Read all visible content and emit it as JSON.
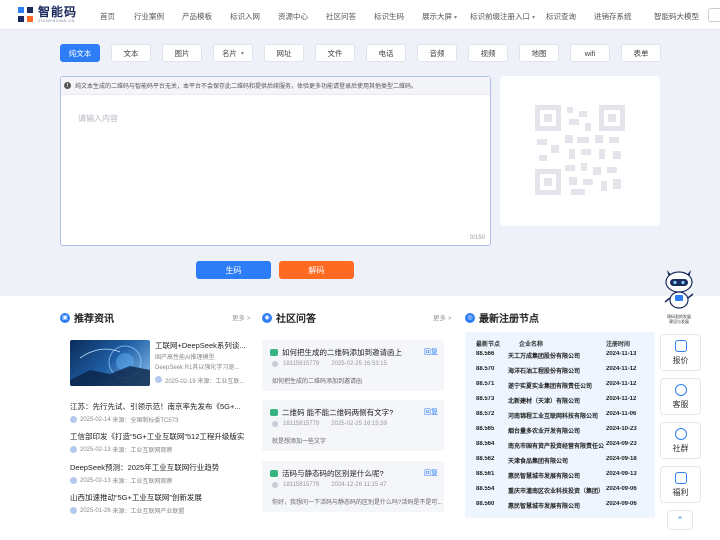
{
  "logo": {
    "name": "智能码",
    "domain": "ZHINENGMA.CN"
  },
  "nav": [
    {
      "label": "首页"
    },
    {
      "label": "行业案例"
    },
    {
      "label": "产品模板"
    },
    {
      "label": "标识入网"
    },
    {
      "label": "资源中心"
    },
    {
      "label": "社区问答"
    },
    {
      "label": "标识生码"
    },
    {
      "label": "展示大屏"
    },
    {
      "label": "标识前缀注册入口"
    },
    {
      "label": "标识查询"
    },
    {
      "label": "进销存系统"
    },
    {
      "label": "智能码大模型"
    }
  ],
  "tabs": [
    "纯文本",
    "文本",
    "图片",
    "名片",
    "网址",
    "文件",
    "电话",
    "音频",
    "视频",
    "地图",
    "wifi",
    "表单"
  ],
  "editor": {
    "notice": "纯文本生成的二维码与智能码平台无关，本平台不会保存此二维码和提供后续服务，体验更多功能请登录后使用其他类型二维码。",
    "placeholder": "请输入内容",
    "counter": "0/150"
  },
  "buttons": {
    "generate": "生码",
    "decode": "解码"
  },
  "news": {
    "title": "推荐资讯",
    "more": "更多 >",
    "feature": {
      "title": "工联网+DeepSeek系列谈...",
      "desc1": "国产高性能AI推理模型",
      "desc2": "DeepSeek R1其以强化学习驱...",
      "date": "2025-02-19",
      "source": "来源：工业互联..."
    },
    "items": [
      {
        "title": "江苏：先行先试、引领示范！南京率先发布《5G+...",
        "date": "2025-02-14",
        "source": "来源：全国制标委TC573"
      },
      {
        "title": "工信部印发《打造“5G+工业互联网”512工程升级版实...",
        "date": "2025-02-13",
        "source": "来源：工业互联网观察"
      },
      {
        "title": "DeepSeek预测：2025年工业互联网行业趋势",
        "date": "2025-02-13",
        "source": "来源：工业互联网观察"
      },
      {
        "title": "山西加速推动“5G+工业互联网”创新发展",
        "date": "2025-01-26",
        "source": "来源：工业互联网产业联盟"
      }
    ]
  },
  "qa": {
    "title": "社区问答",
    "more": "更多 >",
    "reply_label": "回复",
    "items": [
      {
        "q": "如何把生成的二维码添加到邀请函上",
        "user": "18115815779",
        "date": "2025-02-25 16:53:15",
        "a": "如何把生成的二维码添加到邀请函"
      },
      {
        "q": "二维码 能不能二维码两侧有文字?",
        "user": "18115815779",
        "date": "2025-02-25 16:15:39",
        "a": "就是想添加一些文字"
      },
      {
        "q": "活码与静态码的区别是什么呢?",
        "user": "18115815779",
        "date": "2024-12-26 11:15:47",
        "a": "你好，我想问一下活码与静态码的区别是什么吗?活码是不是可..."
      }
    ]
  },
  "nodes": {
    "title": "最新注册节点",
    "headers": [
      "最新节点",
      "企业名称",
      "注册时间"
    ],
    "rows": [
      [
        "88.566",
        "天工万成集团股份有限公司",
        "2024-11-13"
      ],
      [
        "88.570",
        "海洋石油工程股份有限公司",
        "2024-11-12"
      ],
      [
        "88.571",
        "遂宁实夏实业集团有限责任公司",
        "2024-11-12"
      ],
      [
        "88.573",
        "北新建材（天津）有限公司",
        "2024-11-12"
      ],
      [
        "88.572",
        "河南锦程工业互联网科技有限公司",
        "2024-11-06"
      ],
      [
        "88.565",
        "烟台量多农业开发有限公司",
        "2024-10-23"
      ],
      [
        "88.564",
        "南充市国有资产投资经营有限责任公",
        "2024-09-23"
      ],
      [
        "88.562",
        "天津食品集团有限公司",
        "2024-09-18"
      ],
      [
        "88.561",
        "惠民智慧城市发展有限公司",
        "2024-09-13"
      ],
      [
        "88.554",
        "重庆市潼南区农业科技投资（集团）",
        "2024-09-06"
      ],
      [
        "88.560",
        "惠民智慧城市发展有限公司",
        "2024-09-06"
      ]
    ]
  },
  "side": {
    "mascot_caption": "锦码君的发展\n建设与发展",
    "buttons": [
      {
        "label": "报价",
        "icon": "quote-icon"
      },
      {
        "label": "客服",
        "icon": "headset-icon"
      },
      {
        "label": "社群",
        "icon": "community-icon"
      },
      {
        "label": "福利",
        "icon": "gift-icon"
      }
    ],
    "top_label": "⌃"
  },
  "colors": {
    "primary": "#2d7df6",
    "decode": "#ff6a23",
    "qa_bubble": "#36b37e"
  }
}
